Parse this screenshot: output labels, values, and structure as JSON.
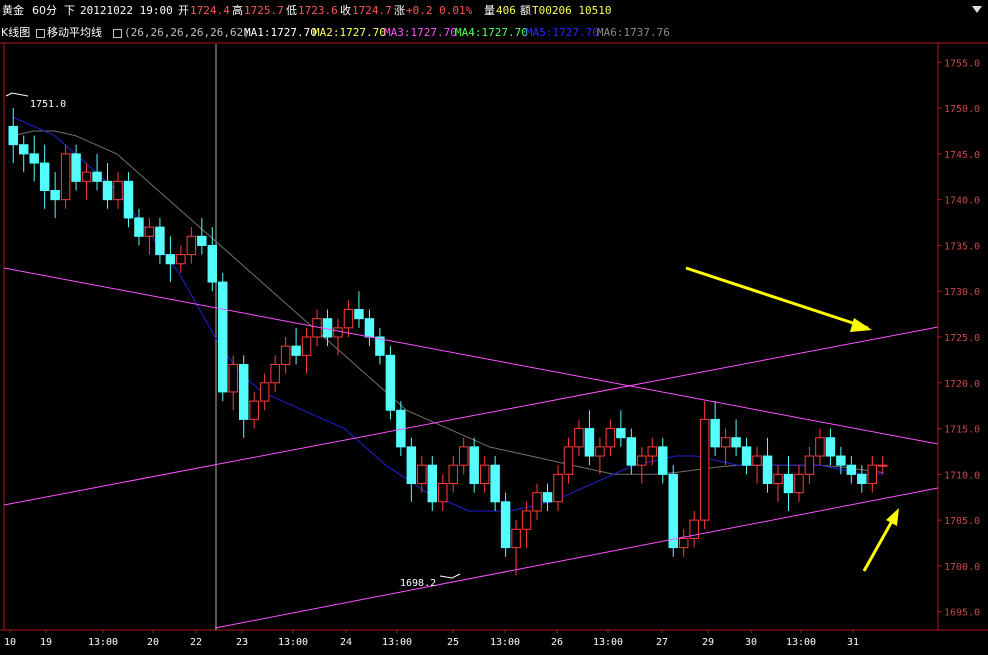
{
  "header": {
    "symbol": "黄金",
    "period": "60分",
    "direction": "下",
    "datetime": "20121022 19:00",
    "open_label": "开",
    "open": "1724.4",
    "high_label": "高",
    "high": "1725.7",
    "low_label": "低",
    "low": "1723.6",
    "close_label": "收",
    "close": "1724.7",
    "change_label": "涨",
    "change": "+0.2 0.01%",
    "volume_label": "量",
    "volume": "406",
    "amount_label": "额",
    "amount": "T00206 10510"
  },
  "indicator": {
    "chart_name": "K线图",
    "ma_name": "移动平均线",
    "params": "(26,26,26,26,26,62)",
    "ma1": "MA1:1727.70",
    "ma2": "MA2:1727.70",
    "ma3": "MA3:1727.70",
    "ma4": "MA4:1727.70",
    "ma5": "MA5:1727.70",
    "ma6": "MA6:1737.76"
  },
  "colors": {
    "up": "#ff3c3c",
    "down": "#54fcfc",
    "axis": "#b01818",
    "axis_text": "#c84848",
    "ma_blue": "#2020d8",
    "ma_gray": "#707070",
    "trend": "#ff50ff",
    "arrow": "#ffff00",
    "white": "#ffffff",
    "yellow": "#ffff54",
    "magenta": "#ff54ff",
    "green": "#54ff54"
  },
  "chart_data": {
    "type": "candlestick",
    "ylim": [
      1693.0,
      1757.0
    ],
    "yticks": [
      "1755.0",
      "1750.0",
      "1745.0",
      "1740.0",
      "1735.0",
      "1730.0",
      "1725.0",
      "1720.0",
      "1715.0",
      "1710.0",
      "1705.0",
      "1700.0",
      "1695.0"
    ],
    "xticks": [
      "10",
      "19",
      "13:00",
      "20",
      "22",
      "23",
      "13:00",
      "24",
      "13:00",
      "25",
      "13:00",
      "26",
      "13:00",
      "27",
      "29",
      "30",
      "13:00",
      "31"
    ],
    "annotations": {
      "high_label": "1751.0",
      "low_label": "1698.2"
    },
    "candles": [
      [
        1748,
        1750,
        1744,
        1746
      ],
      [
        1746,
        1747,
        1743,
        1745
      ],
      [
        1745,
        1747,
        1742,
        1744
      ],
      [
        1744,
        1746,
        1739,
        1741
      ],
      [
        1741,
        1743,
        1738,
        1740
      ],
      [
        1740,
        1746,
        1739,
        1745
      ],
      [
        1745,
        1746,
        1741,
        1742
      ],
      [
        1742,
        1744,
        1740,
        1743
      ],
      [
        1743,
        1745,
        1741,
        1742
      ],
      [
        1742,
        1744,
        1739,
        1740
      ],
      [
        1740,
        1743,
        1739,
        1742
      ],
      [
        1742,
        1743,
        1737,
        1738
      ],
      [
        1738,
        1739,
        1735,
        1736
      ],
      [
        1736,
        1738,
        1734,
        1737
      ],
      [
        1737,
        1738,
        1733,
        1734
      ],
      [
        1734,
        1736,
        1731,
        1733
      ],
      [
        1733,
        1735,
        1732,
        1734
      ],
      [
        1734,
        1737,
        1733,
        1736
      ],
      [
        1736,
        1738,
        1734,
        1735
      ],
      [
        1735,
        1737,
        1730,
        1731
      ],
      [
        1731,
        1732,
        1718,
        1719
      ],
      [
        1719,
        1723,
        1717,
        1722
      ],
      [
        1722,
        1723,
        1714,
        1716
      ],
      [
        1716,
        1719,
        1715,
        1718
      ],
      [
        1718,
        1721,
        1717,
        1720
      ],
      [
        1720,
        1723,
        1719,
        1722
      ],
      [
        1722,
        1725,
        1721,
        1724
      ],
      [
        1724,
        1726,
        1722,
        1723
      ],
      [
        1723,
        1726,
        1721,
        1725
      ],
      [
        1725,
        1728,
        1724,
        1727
      ],
      [
        1727,
        1728,
        1724,
        1725
      ],
      [
        1725,
        1727,
        1723,
        1726
      ],
      [
        1726,
        1729,
        1725,
        1728
      ],
      [
        1728,
        1730,
        1726,
        1727
      ],
      [
        1727,
        1728,
        1724,
        1725
      ],
      [
        1725,
        1726,
        1722,
        1723
      ],
      [
        1723,
        1724,
        1716,
        1717
      ],
      [
        1717,
        1718,
        1712,
        1713
      ],
      [
        1713,
        1714,
        1707,
        1709
      ],
      [
        1709,
        1712,
        1708,
        1711
      ],
      [
        1711,
        1712,
        1706,
        1707
      ],
      [
        1707,
        1710,
        1706,
        1709
      ],
      [
        1709,
        1712,
        1708,
        1711
      ],
      [
        1711,
        1714,
        1710,
        1713
      ],
      [
        1713,
        1714,
        1708,
        1709
      ],
      [
        1709,
        1712,
        1708,
        1711
      ],
      [
        1711,
        1712,
        1706,
        1707
      ],
      [
        1707,
        1708,
        1701,
        1702
      ],
      [
        1702,
        1705,
        1699,
        1704
      ],
      [
        1704,
        1707,
        1702,
        1706
      ],
      [
        1706,
        1709,
        1705,
        1708
      ],
      [
        1708,
        1709,
        1706,
        1707
      ],
      [
        1707,
        1711,
        1706,
        1710
      ],
      [
        1710,
        1714,
        1709,
        1713
      ],
      [
        1713,
        1716,
        1712,
        1715
      ],
      [
        1715,
        1717,
        1711,
        1712
      ],
      [
        1712,
        1714,
        1710,
        1713
      ],
      [
        1713,
        1716,
        1712,
        1715
      ],
      [
        1715,
        1717,
        1713,
        1714
      ],
      [
        1714,
        1715,
        1710,
        1711
      ],
      [
        1711,
        1713,
        1709,
        1712
      ],
      [
        1712,
        1714,
        1711,
        1713
      ],
      [
        1713,
        1714,
        1709,
        1710
      ],
      [
        1710,
        1711,
        1701,
        1702
      ],
      [
        1702,
        1704,
        1701,
        1703
      ],
      [
        1703,
        1706,
        1702,
        1705
      ],
      [
        1705,
        1718,
        1704,
        1716
      ],
      [
        1716,
        1718,
        1712,
        1713
      ],
      [
        1713,
        1715,
        1711,
        1714
      ],
      [
        1714,
        1716,
        1712,
        1713
      ],
      [
        1713,
        1714,
        1710,
        1711
      ],
      [
        1711,
        1713,
        1709,
        1712
      ],
      [
        1712,
        1714,
        1708,
        1709
      ],
      [
        1709,
        1711,
        1707,
        1710
      ],
      [
        1710,
        1712,
        1706,
        1708
      ],
      [
        1708,
        1711,
        1707,
        1710
      ],
      [
        1710,
        1713,
        1709,
        1712
      ],
      [
        1712,
        1715,
        1711,
        1714
      ],
      [
        1714,
        1715,
        1711,
        1712
      ],
      [
        1712,
        1713,
        1710,
        1711
      ],
      [
        1711,
        1712,
        1709,
        1710
      ],
      [
        1710,
        1711,
        1708,
        1709
      ],
      [
        1709,
        1712,
        1708,
        1711
      ],
      [
        1711,
        1712,
        1710,
        1711
      ]
    ],
    "ma_blue": [
      1749,
      1748,
      1747,
      1745,
      1743,
      1741,
      1738,
      1735,
      1732,
      1728,
      1724,
      1721,
      1719,
      1718,
      1717,
      1716,
      1715,
      1713,
      1711,
      1709.5,
      1708,
      1707,
      1706,
      1706,
      1706,
      1706.5,
      1707,
      1708,
      1709,
      1710,
      1711,
      1711.5,
      1712,
      1712,
      1711.5,
      1711,
      1711,
      1711,
      1711,
      1711,
      1710.5,
      1710,
      1710
    ],
    "ma_gray": [
      1747,
      1747.5,
      1747.5,
      1747,
      1746,
      1745,
      1743,
      1741,
      1739,
      1737,
      1735,
      1733,
      1731,
      1729,
      1727,
      1725,
      1723,
      1721,
      1719,
      1717,
      1716,
      1715,
      1714,
      1713,
      1712.5,
      1712,
      1711.5,
      1711,
      1710.5,
      1710,
      1710,
      1710,
      1710.2,
      1710.5,
      1710.8,
      1711,
      1711,
      1711,
      1711,
      1711,
      1710.8,
      1710.5,
      1710.2
    ]
  }
}
